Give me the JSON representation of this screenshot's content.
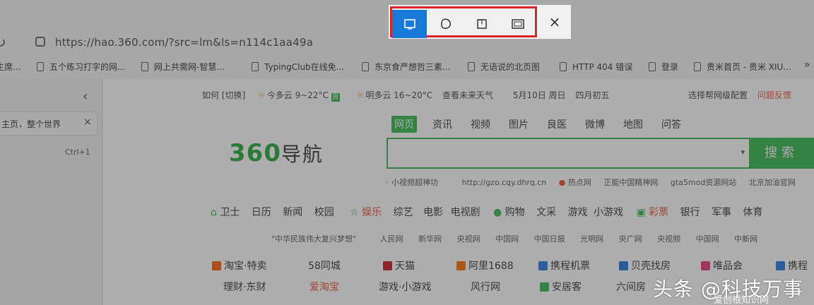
{
  "browser": {
    "url": "https://hao.360.com/?src=lm&ls=n114c1aa49a",
    "bookmarks": [
      "生席...",
      "五个练习打字的网...",
      "网上共需网-智慧...",
      "TypingClub在线免...",
      "东京食严想哲三素...",
      "无语说的北页图",
      "HTTP 404 错误",
      "登录",
      "贵米首页 - 贵米 XIU...",
      "»"
    ],
    "sidebar": {
      "collapse_glyph": "‹",
      "tab_label": "主页，整个世界",
      "tab_close_glyph": "×",
      "shortcut": "Ctrl+1"
    }
  },
  "page": {
    "info": {
      "location": "如何 [切换]",
      "weather_today": "今多云 9~22°C",
      "weather_badge": "良",
      "weather_tomorrow": "明多云 16~20°C",
      "weather_link": "查看未来天气",
      "date": "5月10日 周日",
      "lunar": "四月初五",
      "promo": "选择帮网级配置",
      "promo_red": "问题反馈"
    },
    "search_tabs": [
      "网页",
      "资讯",
      "视频",
      "图片",
      "良医",
      "微博",
      "地图",
      "问答"
    ],
    "logo_number": "360",
    "logo_text": "导航",
    "search_caret": "▾",
    "search_button": "搜索",
    "hot_links": [
      "小视频超神功",
      "http://gzo.cqy.dhrq.cn",
      "热点网",
      "正能中国精神网",
      "gta5mod资源网站",
      "北京加油官网"
    ],
    "categories": [
      "卫士",
      "日历",
      "新闻",
      "校园",
      "娱乐",
      "综艺",
      "电影",
      "电视剧",
      "购物",
      "文采",
      "游戏",
      "小游戏",
      "彩票",
      "银行",
      "军事",
      "体育"
    ],
    "news_links": [
      "\"中华民族伟大复兴梦想\"",
      "人民网",
      "新华网",
      "央视网",
      "中国网",
      "中国日报",
      "光明网",
      "央广网",
      "央视频",
      "中国网",
      "中新网"
    ],
    "sites_row1": [
      "淘宝·特卖",
      "58同城",
      "天猫",
      "阿里1688",
      "携程机票",
      "贝壳找房",
      "唯品会",
      "携程"
    ],
    "sites_row2": [
      "理财·东财",
      "爱淘宝",
      "游戏·小游戏",
      "风行网",
      "安居客",
      "六间房"
    ]
  },
  "snip_toolbar": {
    "modes": [
      {
        "name": "rectangle-snip",
        "active": true
      },
      {
        "name": "freeform-snip",
        "active": false
      },
      {
        "name": "window-snip",
        "active": false
      },
      {
        "name": "fullscreen-snip",
        "active": false
      }
    ],
    "close_glyph": "×"
  },
  "watermark": {
    "source": "头条",
    "handle": "@科技万事",
    "overlay": "爱创根知识网"
  },
  "colors": {
    "accent_green": "#2fb54a",
    "highlight_red": "#d9262b",
    "active_blue": "#1a78d8"
  }
}
